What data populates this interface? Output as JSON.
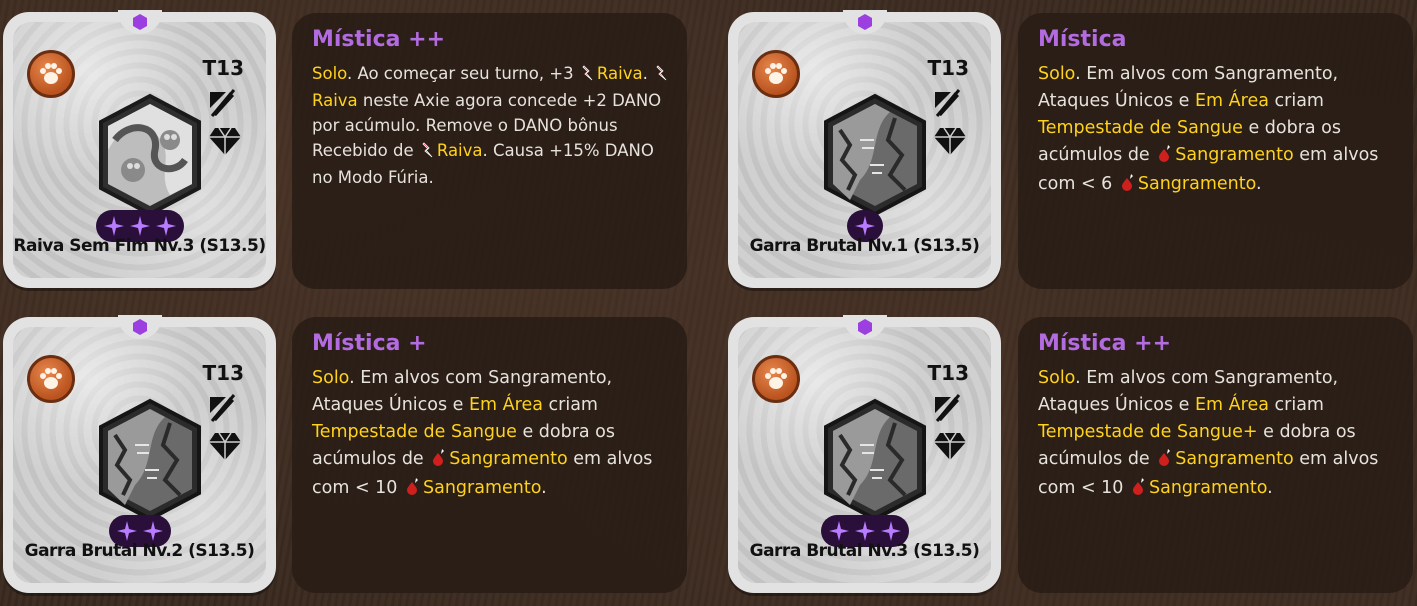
{
  "cards": [
    {
      "tier": "T13",
      "name": "Raiva Sem Fim Nv.3 (S13.5)",
      "pips": 3,
      "rarity": "Mística ++",
      "art": "swirl",
      "desc": [
        {
          "t": "Solo",
          "kw": true
        },
        {
          "t": ". Ao começar seu turno, +3 "
        },
        {
          "icon": "rage-icon"
        },
        {
          "t": "Raiva",
          "kw": true
        },
        {
          "t": ". "
        },
        {
          "icon": "rage-icon"
        },
        {
          "t": "Raiva",
          "kw": true
        },
        {
          "t": " neste Axie agora concede +2 DANO por acúmulo. Remove o DANO bônus Recebido de "
        },
        {
          "icon": "rage-icon"
        },
        {
          "t": "Raiva",
          "kw": true
        },
        {
          "t": ". Causa +15% DANO no Modo Fúria."
        }
      ]
    },
    {
      "tier": "T13",
      "name": "Garra Brutal Nv.1 (S13.5)",
      "pips": 1,
      "rarity": "Mística",
      "art": "claw",
      "desc": [
        {
          "t": "Solo",
          "kw": true
        },
        {
          "t": ". Em alvos com Sangramento, Ataques Únicos e "
        },
        {
          "t": "Em Área",
          "kw": true
        },
        {
          "t": " criam "
        },
        {
          "t": "Tempestade de Sangue",
          "kw": true
        },
        {
          "t": " e dobra os acúmulos de "
        },
        {
          "icon": "bleed-icon"
        },
        {
          "t": "Sangramento",
          "kw": true
        },
        {
          "t": " em alvos com < 6 "
        },
        {
          "icon": "bleed-icon"
        },
        {
          "t": "Sangramento",
          "kw": true
        },
        {
          "t": "."
        }
      ]
    },
    {
      "tier": "T13",
      "name": "Garra Brutal Nv.2 (S13.5)",
      "pips": 2,
      "rarity": "Mística +",
      "art": "claw",
      "desc": [
        {
          "t": "Solo",
          "kw": true
        },
        {
          "t": ". Em alvos com Sangramento, Ataques Únicos e "
        },
        {
          "t": "Em Área",
          "kw": true
        },
        {
          "t": " criam "
        },
        {
          "t": "Tempestade de Sangue",
          "kw": true
        },
        {
          "t": " e dobra os acúmulos de "
        },
        {
          "icon": "bleed-icon"
        },
        {
          "t": "Sangramento",
          "kw": true
        },
        {
          "t": " em alvos com < 10 "
        },
        {
          "icon": "bleed-icon"
        },
        {
          "t": "Sangramento",
          "kw": true
        },
        {
          "t": "."
        }
      ]
    },
    {
      "tier": "T13",
      "name": "Garra Brutal Nv.3 (S13.5)",
      "pips": 3,
      "rarity": "Mística ++",
      "art": "claw",
      "desc": [
        {
          "t": "Solo",
          "kw": true
        },
        {
          "t": ". Em alvos com Sangramento, Ataques Únicos e "
        },
        {
          "t": "Em Área",
          "kw": true
        },
        {
          "t": " criam "
        },
        {
          "t": "Tempestade de Sangue+",
          "kw": true
        },
        {
          "t": " e dobra os acúmulos de "
        },
        {
          "icon": "bleed-icon"
        },
        {
          "t": "Sangramento",
          "kw": true
        },
        {
          "t": " em alvos com < 10 "
        },
        {
          "icon": "bleed-icon"
        },
        {
          "t": "Sangramento",
          "kw": true
        },
        {
          "t": "."
        }
      ]
    }
  ],
  "colors": {
    "rarity": "#b36be0",
    "keyword": "#ffd21c",
    "text": "#e6e2dc",
    "pip": "#b77cff"
  }
}
